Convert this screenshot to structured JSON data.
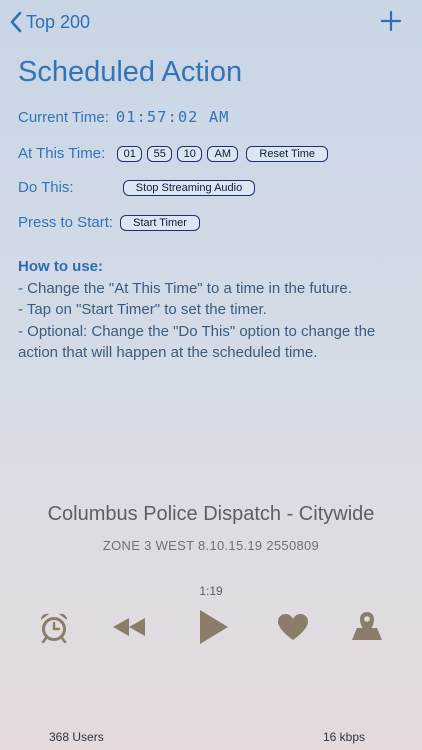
{
  "nav": {
    "back_label": "Top 200"
  },
  "title": "Scheduled Action",
  "current_time": {
    "label": "Current Time:",
    "value": "01:57:02 AM"
  },
  "at_this_time": {
    "label": "At This Time:",
    "hour": "01",
    "minute": "55",
    "second": "10",
    "ampm": "AM",
    "reset_label": "Reset Time"
  },
  "do_this": {
    "label": "Do This:",
    "action": "Stop Streaming Audio"
  },
  "press_to_start": {
    "label": "Press to Start:",
    "button": "Start Timer"
  },
  "help": {
    "heading": "How to use:",
    "lines": [
      "- Change the \"At This Time\" to a time in the future.",
      "- Tap on \"Start Timer\" to set the timer.",
      "- Optional: Change the \"Do This\" option to change the action that will happen at the scheduled time."
    ]
  },
  "player": {
    "station": "Columbus Police Dispatch - Citywide",
    "now_playing": "ZONE 3 WEST 8.10.15.19 2550809",
    "elapsed": "1:19",
    "users": "368 Users",
    "bitrate": "16 kbps"
  },
  "colors": {
    "accent": "#3573b9",
    "icon": "#8a7e6a"
  },
  "icons": [
    "chevron-left-icon",
    "plus-icon",
    "alarm-clock-icon",
    "rewind-icon",
    "play-icon",
    "heart-icon",
    "map-pin-icon"
  ]
}
